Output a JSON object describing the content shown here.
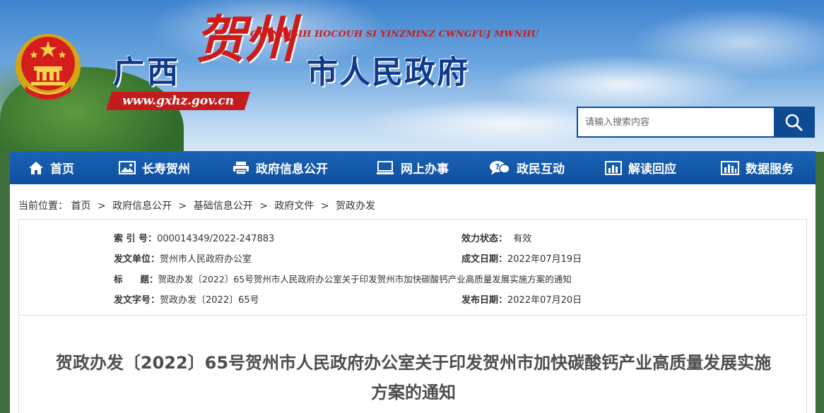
{
  "header": {
    "title_part1": "广西",
    "title_part2": "贺州",
    "title_part3": "市人民政府",
    "pinyin": "GVANGJSIH HOCOUH SI YINZMINZ CWNGFUJ MWNHU",
    "url": "www.gxhz.gov.cn",
    "emblem_icon": "national-emblem-icon"
  },
  "search": {
    "placeholder": "请输入搜索内容",
    "button_icon": "search-icon"
  },
  "nav": {
    "items": [
      {
        "label": "首页",
        "icon": "home-icon"
      },
      {
        "label": "长寿贺州",
        "icon": "image-icon"
      },
      {
        "label": "政府信息公开",
        "icon": "printer-icon"
      },
      {
        "label": "网上办事",
        "icon": "monitor-icon"
      },
      {
        "label": "政民互动",
        "icon": "chat-icon"
      },
      {
        "label": "解读回应",
        "icon": "bar-chart-icon"
      },
      {
        "label": "数据服务",
        "icon": "data-chart-icon"
      }
    ]
  },
  "breadcrumb": {
    "prefix": "当前位置：",
    "items": [
      "首页",
      "政府信息公开",
      "基础信息公开",
      "政府文件",
      "贺政办发"
    ],
    "separator": ">"
  },
  "meta": {
    "index_label": "索 引 号：",
    "index_value": "000014349/2022-247883",
    "status_label": "效力状态：",
    "status_value": "有效",
    "issuer_label": "发文单位：",
    "issuer_value": "贺州市人民政府办公室",
    "created_label": "成文日期：",
    "created_value": "2022年07月19日",
    "subject_label": "标　　题：",
    "subject_value": "贺政办发〔2022〕65号贺州市人民政府办公室关于印发贺州市加快碳酸钙产业高质量发展实施方案的通知",
    "docno_label": "发文字号：",
    "docno_value": "贺政办发〔2022〕65号",
    "published_label": "发布日期：",
    "published_value": "2022年07月20日"
  },
  "document": {
    "title": "贺政办发〔2022〕65号贺州市人民政府办公室关于印发贺州市加快碳酸钙产业高质量发展实施方案的通知"
  },
  "colors": {
    "nav_blue": "#0e4f9e",
    "title_blue": "#0f3a8c",
    "accent_red": "#cf1a1a"
  }
}
